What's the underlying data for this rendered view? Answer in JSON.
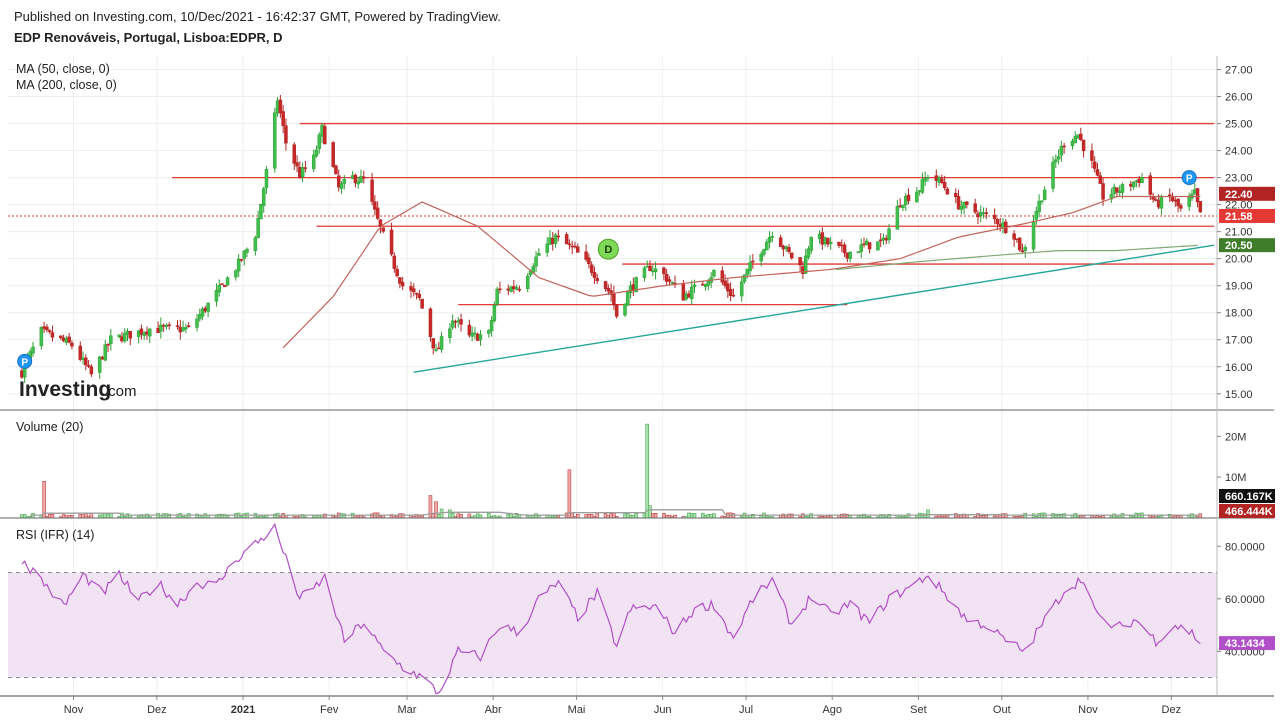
{
  "header": {
    "published": "Published on Investing.com, 10/Dec/2021 - 16:42:37 GMT, Powered by TradingView.",
    "symbol": "EDP Renováveis, Portugal, Lisboa:EDPR, D"
  },
  "brand": {
    "name": "Investing",
    "suffix": ".com"
  },
  "panes": {
    "price": {
      "legend": [
        "MA (50, close, 0)",
        "MA (200, close, 0)"
      ]
    },
    "volume": {
      "legend": "Volume (20)"
    },
    "rsi": {
      "legend": "RSI (IFR) (14)"
    }
  },
  "colors": {
    "up": "#2e9e35",
    "up_fill": "#3fbf4c",
    "down": "#b22424",
    "down_fill": "#c62828",
    "ma50": "#c0645a",
    "ma200": "#7fa872",
    "trend": "#26a69a",
    "hline": "#e53935",
    "rsi": "#b14fc8",
    "rsi_band": "#f1e3f3",
    "grid": "#eeeeee",
    "vol_ma": "#9e9e9e",
    "marker_p": "#2196f3",
    "marker_d": "#7ed957"
  },
  "chart_data": [
    {
      "type": "candlestick",
      "title": "EDP Renováveis, Portugal, Lisboa:EDPR, D",
      "x_axis_ticks": [
        "Nov",
        "Dez",
        "2021",
        "Fev",
        "Mar",
        "Abr",
        "Mai",
        "Jun",
        "Jul",
        "Ago",
        "Set",
        "Out",
        "Nov",
        "Dez"
      ],
      "y_ticks": [
        "15.00",
        "16.00",
        "17.00",
        "18.00",
        "19.00",
        "20.00",
        "21.00",
        "22.00",
        "23.00",
        "24.00",
        "25.00",
        "26.00",
        "27.00"
      ],
      "ylim": [
        14.4,
        27.5
      ],
      "close_anchors": [
        [
          "2020-10-12",
          15.8
        ],
        [
          "2020-10-19",
          17.3
        ],
        [
          "2020-10-30",
          16.8
        ],
        [
          "2020-11-06",
          15.7
        ],
        [
          "2020-11-13",
          17.0
        ],
        [
          "2020-11-27",
          17.4
        ],
        [
          "2020-12-11",
          17.4
        ],
        [
          "2020-12-18",
          18.3
        ],
        [
          "2020-12-29",
          19.8
        ],
        [
          "2021-01-04",
          20.9
        ],
        [
          "2021-01-08",
          23.2
        ],
        [
          "2021-01-12",
          25.9
        ],
        [
          "2021-01-15",
          24.3
        ],
        [
          "2021-01-20",
          23.1
        ],
        [
          "2021-01-25",
          23.7
        ],
        [
          "2021-01-28",
          24.8
        ],
        [
          "2021-02-03",
          22.6
        ],
        [
          "2021-02-08",
          23.0
        ],
        [
          "2021-02-12",
          22.9
        ],
        [
          "2021-02-17",
          21.4
        ],
        [
          "2021-02-22",
          20.0
        ],
        [
          "2021-02-26",
          19.0
        ],
        [
          "2021-03-04",
          18.5
        ],
        [
          "2021-03-10",
          16.5
        ],
        [
          "2021-03-16",
          17.8
        ],
        [
          "2021-03-22",
          17.1
        ],
        [
          "2021-03-29",
          17.2
        ],
        [
          "2021-04-01",
          18.8
        ],
        [
          "2021-04-09",
          19.0
        ],
        [
          "2021-04-16",
          20.2
        ],
        [
          "2021-04-22",
          20.8
        ],
        [
          "2021-04-29",
          20.3
        ],
        [
          "2021-05-05",
          19.6
        ],
        [
          "2021-05-12",
          18.7
        ],
        [
          "2021-05-14",
          17.9
        ],
        [
          "2021-05-19",
          18.9
        ],
        [
          "2021-05-26",
          19.7
        ],
        [
          "2021-05-31",
          19.4
        ],
        [
          "2021-06-07",
          18.6
        ],
        [
          "2021-06-14",
          19.1
        ],
        [
          "2021-06-18",
          19.5
        ],
        [
          "2021-06-25",
          18.6
        ],
        [
          "2021-07-01",
          19.7
        ],
        [
          "2021-07-06",
          20.5
        ],
        [
          "2021-07-09",
          21.0
        ],
        [
          "2021-07-14",
          20.3
        ],
        [
          "2021-07-20",
          19.6
        ],
        [
          "2021-07-23",
          20.9
        ],
        [
          "2021-07-30",
          20.5
        ],
        [
          "2021-08-05",
          20.2
        ],
        [
          "2021-08-12",
          20.5
        ],
        [
          "2021-08-18",
          20.6
        ],
        [
          "2021-08-24",
          22.1
        ],
        [
          "2021-08-31",
          22.6
        ],
        [
          "2021-09-03",
          23.1
        ],
        [
          "2021-09-08",
          22.8
        ],
        [
          "2021-09-14",
          22.0
        ],
        [
          "2021-09-21",
          21.7
        ],
        [
          "2021-09-28",
          21.4
        ],
        [
          "2021-10-04",
          20.9
        ],
        [
          "2021-10-07",
          20.2
        ],
        [
          "2021-10-12",
          21.8
        ],
        [
          "2021-10-18",
          23.4
        ],
        [
          "2021-10-22",
          24.3
        ],
        [
          "2021-10-27",
          24.6
        ],
        [
          "2021-11-01",
          23.5
        ],
        [
          "2021-11-05",
          22.3
        ],
        [
          "2021-11-12",
          22.6
        ],
        [
          "2021-11-19",
          23.0
        ],
        [
          "2021-11-24",
          22.0
        ],
        [
          "2021-11-29",
          22.3
        ],
        [
          "2021-12-03",
          21.8
        ],
        [
          "2021-12-08",
          22.4
        ],
        [
          "2021-12-10",
          21.6
        ]
      ],
      "ma50_anchors": [
        [
          "2021-01-14",
          16.7
        ],
        [
          "2021-02-01",
          18.6
        ],
        [
          "2021-02-18",
          21.2
        ],
        [
          "2021-03-05",
          22.1
        ],
        [
          "2021-03-25",
          21.2
        ],
        [
          "2021-04-16",
          19.3
        ],
        [
          "2021-05-05",
          18.6
        ],
        [
          "2021-05-31",
          19.0
        ],
        [
          "2021-06-25",
          19.3
        ],
        [
          "2021-07-30",
          19.6
        ],
        [
          "2021-08-24",
          20.0
        ],
        [
          "2021-09-14",
          20.8
        ],
        [
          "2021-10-08",
          21.3
        ],
        [
          "2021-10-25",
          21.7
        ],
        [
          "2021-11-10",
          22.3
        ],
        [
          "2021-12-10",
          22.3
        ]
      ],
      "ma200_anchors": [
        [
          "2021-08-01",
          19.6
        ],
        [
          "2021-09-01",
          19.9
        ],
        [
          "2021-10-01",
          20.15
        ],
        [
          "2021-10-20",
          20.3
        ],
        [
          "2021-11-10",
          20.3
        ],
        [
          "2021-12-10",
          20.5
        ]
      ],
      "horizontal_lines": [
        {
          "from": "2021-01-20",
          "to": "2021-12-15",
          "y": 25.0
        },
        {
          "from": "2020-12-05",
          "to": "2021-12-15",
          "y": 23.0
        },
        {
          "from": "2021-01-26",
          "to": "2021-12-15",
          "y": 21.2
        },
        {
          "from": "2021-05-16",
          "to": "2021-12-15",
          "y": 19.8
        },
        {
          "from": "2021-03-18",
          "to": "2021-08-05",
          "y": 18.3
        }
      ],
      "dotted_line": {
        "y": 21.58
      },
      "trendline": {
        "from": [
          "2021-03-02",
          15.8
        ],
        "to": [
          "2021-12-15",
          20.5
        ]
      },
      "price_labels": [
        {
          "text": "22.40",
          "y": 22.4,
          "color": "#b22424"
        },
        {
          "text": "21.58",
          "y": 21.58,
          "color": "#e53935"
        },
        {
          "text": "20.50",
          "y": 20.5,
          "color": "#3f7d2a"
        }
      ],
      "markers": [
        {
          "label": "P",
          "date": "2020-10-13",
          "y": 16.2
        },
        {
          "label": "D",
          "date": "2021-05-11",
          "y": 20.35
        },
        {
          "label": "P",
          "date": "2021-12-06",
          "y": 23.0
        }
      ]
    },
    {
      "type": "bar",
      "title": "Volume (20)",
      "y_ticks": [
        "10M",
        "20M"
      ],
      "ylim": [
        0,
        24000000
      ],
      "baseline_volume": 600000,
      "spikes": [
        [
          "2020-10-20",
          9000000
        ],
        [
          "2021-03-08",
          5500000
        ],
        [
          "2021-03-10",
          4000000
        ],
        [
          "2021-03-12",
          2200000
        ],
        [
          "2021-03-15",
          2000000
        ],
        [
          "2021-04-27",
          11800000
        ],
        [
          "2021-05-25",
          23000000
        ],
        [
          "2021-05-26",
          3000000
        ],
        [
          "2021-09-03",
          2000000
        ]
      ],
      "value_labels": [
        {
          "text": "660.167K",
          "color": "#111111"
        },
        {
          "text": "466.444K",
          "color": "#b22424"
        }
      ]
    },
    {
      "type": "line",
      "title": "RSI (IFR) (14)",
      "y_ticks": [
        "40.0000",
        "60.0000",
        "80.0000"
      ],
      "ylim": [
        23,
        90
      ],
      "bands": [
        30,
        70
      ],
      "last_label": "43.1434",
      "anchors": [
        [
          "2020-10-12",
          75
        ],
        [
          "2020-10-20",
          66
        ],
        [
          "2020-10-27",
          57
        ],
        [
          "2020-11-03",
          69
        ],
        [
          "2020-11-10",
          62
        ],
        [
          "2020-11-16",
          69
        ],
        [
          "2020-11-23",
          59
        ],
        [
          "2020-11-30",
          66
        ],
        [
          "2020-12-07",
          58
        ],
        [
          "2020-12-14",
          66
        ],
        [
          "2020-12-21",
          65
        ],
        [
          "2020-12-28",
          75
        ],
        [
          "2021-01-04",
          81
        ],
        [
          "2021-01-11",
          87
        ],
        [
          "2021-01-15",
          75
        ],
        [
          "2021-01-20",
          60
        ],
        [
          "2021-01-25",
          64
        ],
        [
          "2021-01-29",
          68
        ],
        [
          "2021-02-05",
          44
        ],
        [
          "2021-02-12",
          51
        ],
        [
          "2021-02-19",
          40
        ],
        [
          "2021-02-26",
          34
        ],
        [
          "2021-03-05",
          30
        ],
        [
          "2021-03-11",
          24
        ],
        [
          "2021-03-18",
          40
        ],
        [
          "2021-03-26",
          38
        ],
        [
          "2021-04-02",
          50
        ],
        [
          "2021-04-09",
          47
        ],
        [
          "2021-04-16",
          60
        ],
        [
          "2021-04-23",
          66
        ],
        [
          "2021-04-30",
          53
        ],
        [
          "2021-05-07",
          62
        ],
        [
          "2021-05-14",
          42
        ],
        [
          "2021-05-19",
          56
        ],
        [
          "2021-05-28",
          57
        ],
        [
          "2021-06-04",
          47
        ],
        [
          "2021-06-11",
          56
        ],
        [
          "2021-06-18",
          58
        ],
        [
          "2021-06-25",
          45
        ],
        [
          "2021-07-02",
          60
        ],
        [
          "2021-07-09",
          67
        ],
        [
          "2021-07-16",
          50
        ],
        [
          "2021-07-23",
          61
        ],
        [
          "2021-07-30",
          54
        ],
        [
          "2021-08-06",
          58
        ],
        [
          "2021-08-13",
          51
        ],
        [
          "2021-08-20",
          60
        ],
        [
          "2021-08-27",
          64
        ],
        [
          "2021-09-03",
          69
        ],
        [
          "2021-09-10",
          61
        ],
        [
          "2021-09-17",
          52
        ],
        [
          "2021-09-24",
          50
        ],
        [
          "2021-10-01",
          44
        ],
        [
          "2021-10-08",
          40
        ],
        [
          "2021-10-15",
          52
        ],
        [
          "2021-10-22",
          63
        ],
        [
          "2021-10-29",
          68
        ],
        [
          "2021-11-03",
          53
        ],
        [
          "2021-11-10",
          49
        ],
        [
          "2021-11-17",
          52
        ],
        [
          "2021-11-24",
          44
        ],
        [
          "2021-12-01",
          50
        ],
        [
          "2021-12-07",
          47
        ],
        [
          "2021-12-10",
          43.14
        ]
      ]
    }
  ]
}
